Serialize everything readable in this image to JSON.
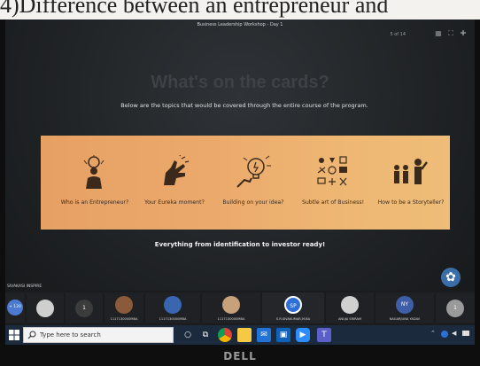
{
  "caption": {
    "text": "4)Difference between an entrepreneur and"
  },
  "meeting": {
    "title": "Business Leadership Workshop - Day 1",
    "slide_counter": "5 of 14"
  },
  "slide": {
    "heading": "What's on the cards?",
    "subtitle": "Below are the topics that would be covered through the entire course of the program.",
    "cards": [
      {
        "icon": "entrepreneur-icon",
        "label": "Who is an Entrepreneur?"
      },
      {
        "icon": "eureka-hand-icon",
        "label": "Your Eureka moment?"
      },
      {
        "icon": "idea-building-icon",
        "label": "Building on your idea?"
      },
      {
        "icon": "business-art-icon",
        "label": "Subtle art of Business!"
      },
      {
        "icon": "storyteller-icon",
        "label": "How to be a Storyteller?"
      }
    ],
    "tagline": "Everything from identification to investor ready!"
  },
  "presenter": {
    "label": "SIVAKASI INSPIRE"
  },
  "participants": [
    {
      "initials": "+ 120",
      "name": "",
      "color": "#4a7bd0"
    },
    {
      "initials": "",
      "name": "",
      "color": "#cfcfcf"
    },
    {
      "initials": "1",
      "name": "",
      "color": "#3c3c3c"
    },
    {
      "initials": "",
      "name": "1117130000MBA",
      "color": "#8a5a3a"
    },
    {
      "initials": "",
      "name": "1117130000MBA",
      "color": "#3a66b0"
    },
    {
      "initials": "",
      "name": "1117130000MBA",
      "color": "#c8a07a"
    },
    {
      "initials": "SP",
      "name": "S.R.SIVAKUMAR,M.BA",
      "color": "#2d6fd6"
    },
    {
      "initials": "",
      "name": "ANUJA SRIRAM",
      "color": "#d0d0d0"
    },
    {
      "initials": "NY",
      "name": "NAGARJUNA YADAV",
      "color": "#3f5ea8"
    },
    {
      "initials": "1",
      "name": "",
      "color": "#9a9a9a"
    }
  ],
  "taskbar": {
    "search_placeholder": "Type here to search",
    "apps": [
      "search-circle-icon",
      "task-view-icon",
      "file-explorer-icon",
      "chrome-icon",
      "mail-icon",
      "outlook-icon",
      "zoom-icon",
      "teams-icon"
    ]
  },
  "bezel": {
    "brand": "DELL"
  },
  "colors": {
    "cards_band": "#eba96b",
    "screen_bg": "#1f2225",
    "taskbar": "#1c2a3d",
    "accent": "#2d6fd6"
  }
}
